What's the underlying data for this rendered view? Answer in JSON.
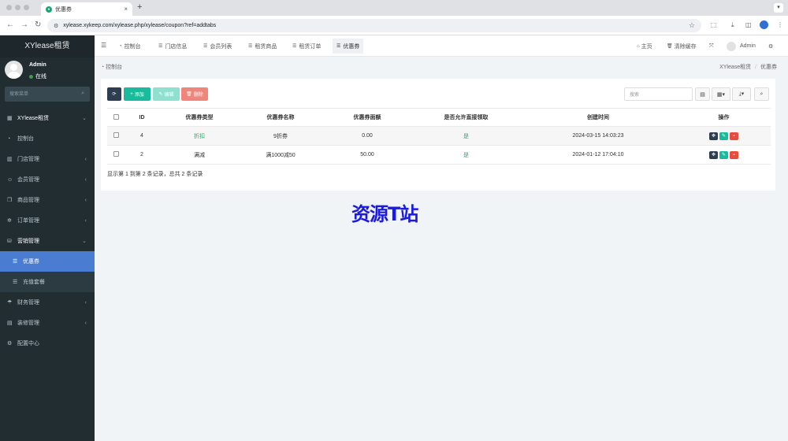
{
  "browser": {
    "tab_title": "优惠券",
    "url": "xylease.xykeep.com/xylease.php/xylease/coupon?ref=addtabs"
  },
  "sidebar": {
    "logo": "XYlease租赁",
    "user_name": "Admin",
    "user_status": "在线",
    "search_placeholder": "搜索菜单",
    "items": [
      {
        "label": "XYlease租赁",
        "icon": "grid-icon"
      },
      {
        "label": "控制台",
        "icon": "dashboard-icon"
      },
      {
        "label": "门店管理",
        "icon": "store-icon"
      },
      {
        "label": "会员管理",
        "icon": "user-icon"
      },
      {
        "label": "商品管理",
        "icon": "goods-icon"
      },
      {
        "label": "订单管理",
        "icon": "order-icon"
      },
      {
        "label": "营销管理",
        "icon": "marketing-icon"
      },
      {
        "label": "优惠券",
        "icon": "list-icon"
      },
      {
        "label": "充值套餐",
        "icon": "list-icon"
      },
      {
        "label": "财务管理",
        "icon": "finance-icon"
      },
      {
        "label": "装修管理",
        "icon": "decor-icon"
      },
      {
        "label": "配置中心",
        "icon": "config-icon"
      }
    ]
  },
  "topnav": {
    "tabs": [
      "控制台",
      "门店信息",
      "会员列表",
      "租赁商品",
      "租赁订单",
      "优惠券"
    ],
    "home": "主页",
    "clear_cache": "清除缓存",
    "admin": "Admin"
  },
  "breadcrumb": {
    "left": "控制台",
    "right_root": "XYlease租赁",
    "right_current": "优惠券"
  },
  "toolbar": {
    "add": "添加",
    "edit": "编辑",
    "delete": "删除",
    "search_placeholder": "搜索"
  },
  "table": {
    "columns": [
      "ID",
      "优惠券类型",
      "优惠券名称",
      "优惠券面额",
      "是否允许直接领取",
      "创建时间",
      "操作"
    ],
    "rows": [
      {
        "id": "4",
        "type": "折扣",
        "name": "9折券",
        "amount": "0.00",
        "direct": "是",
        "created": "2024-03-15 14:03:23"
      },
      {
        "id": "2",
        "type": "满减",
        "name": "满1000减50",
        "amount": "50.00",
        "direct": "是",
        "created": "2024-01-12 17:04:10"
      }
    ],
    "footer": "显示第 1 到第 2 条记录，总共 2 条记录"
  },
  "watermark": "资源T站",
  "colors": {
    "sidebar_bg": "#222d32",
    "active_menu": "#4a7dd1",
    "add_btn": "#18bc9c",
    "delete_btn": "#f0857a",
    "refresh_btn": "#2c3e50"
  }
}
